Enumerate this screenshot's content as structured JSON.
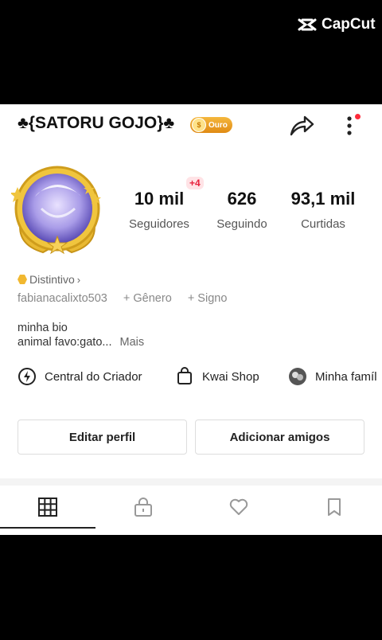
{
  "watermark": {
    "label": "CapCut"
  },
  "profile": {
    "name": "♣{SATORU GOJO}♣",
    "badge_label": "Ouro",
    "stats": [
      {
        "value": "10 mil",
        "label": "Seguidores"
      },
      {
        "value": "626",
        "label": "Seguindo"
      },
      {
        "value": "93,1 mil",
        "label": "Curtidas"
      }
    ],
    "new_followers_badge": "+4",
    "distintivo_label": "Distintivo",
    "username": "fabianacalixto503",
    "add_gender": "+ Gênero",
    "add_sign": "+ Signo",
    "bio_line1": "minha bio",
    "bio_line2": "animal favo:gato...",
    "bio_more": "Mais"
  },
  "tools": [
    {
      "label": "Central do Criador",
      "icon": "lightning-circle-icon"
    },
    {
      "label": "Kwai Shop",
      "icon": "shopping-bag-icon"
    },
    {
      "label": "Minha famíl",
      "icon": "family-avatar-icon"
    }
  ],
  "buttons": {
    "edit_profile": "Editar perfil",
    "add_friends": "Adicionar amigos"
  },
  "tabs": [
    {
      "icon": "grid-icon",
      "selected": true
    },
    {
      "icon": "lock-icon",
      "selected": false
    },
    {
      "icon": "heart-icon",
      "selected": false
    },
    {
      "icon": "bookmark-icon",
      "selected": false
    }
  ],
  "colors": {
    "gold_badge": "#e8951c",
    "notification_red": "#ff2b3b",
    "plus_badge_text": "#e8223d"
  }
}
